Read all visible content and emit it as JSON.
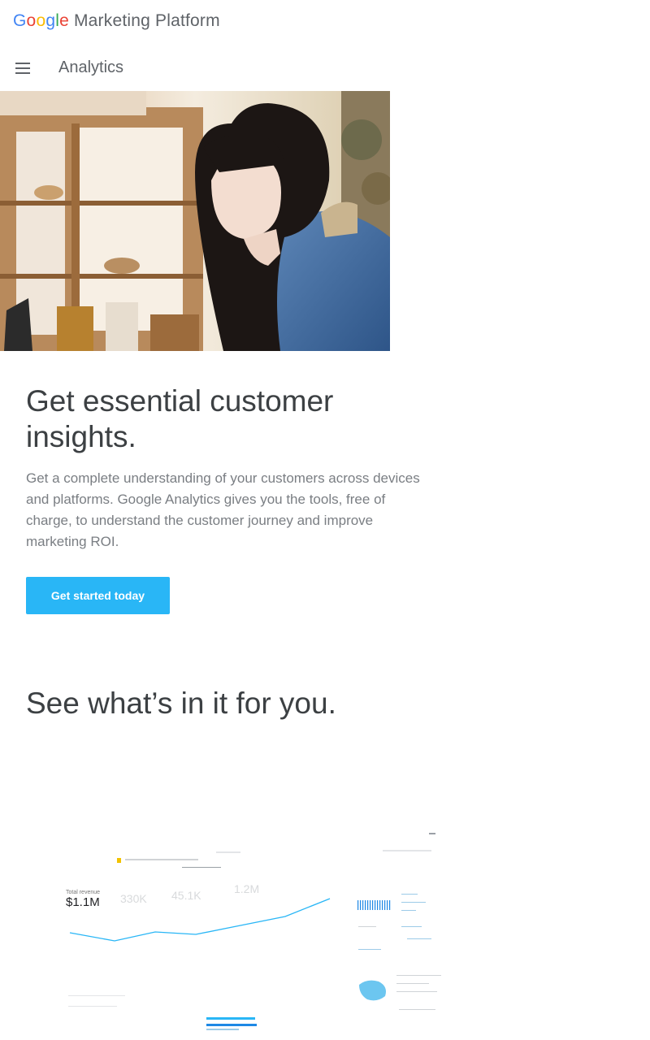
{
  "header": {
    "brand_letters": [
      "G",
      "o",
      "o",
      "g",
      "l",
      "e"
    ],
    "brand_suffix": "Marketing Platform"
  },
  "nav": {
    "menu_icon": "hamburger-menu-icon",
    "product_name": "Analytics"
  },
  "hero": {
    "image_subject": "woman-in-denim-jacket-using-laptop-in-shop"
  },
  "intro": {
    "headline": "Get essential customer insights.",
    "body": "Get a complete understanding of your customers across devices and platforms. Google Analytics gives you the tools, free of charge, to understand the customer journey and improve marketing ROI.",
    "cta_label": "Get started today"
  },
  "section2": {
    "headline": "See what’s in it for you."
  },
  "dashboard_preview": {
    "kpi_label": "Total revenue",
    "kpi_value": "$1.1M",
    "faint_values": [
      "330K",
      "45.1K",
      "1.2M"
    ]
  },
  "colors": {
    "cta_bg": "#29b6f6",
    "headline": "#3c4043",
    "body": "#7a7e83",
    "chart_line": "#29b6f6"
  }
}
